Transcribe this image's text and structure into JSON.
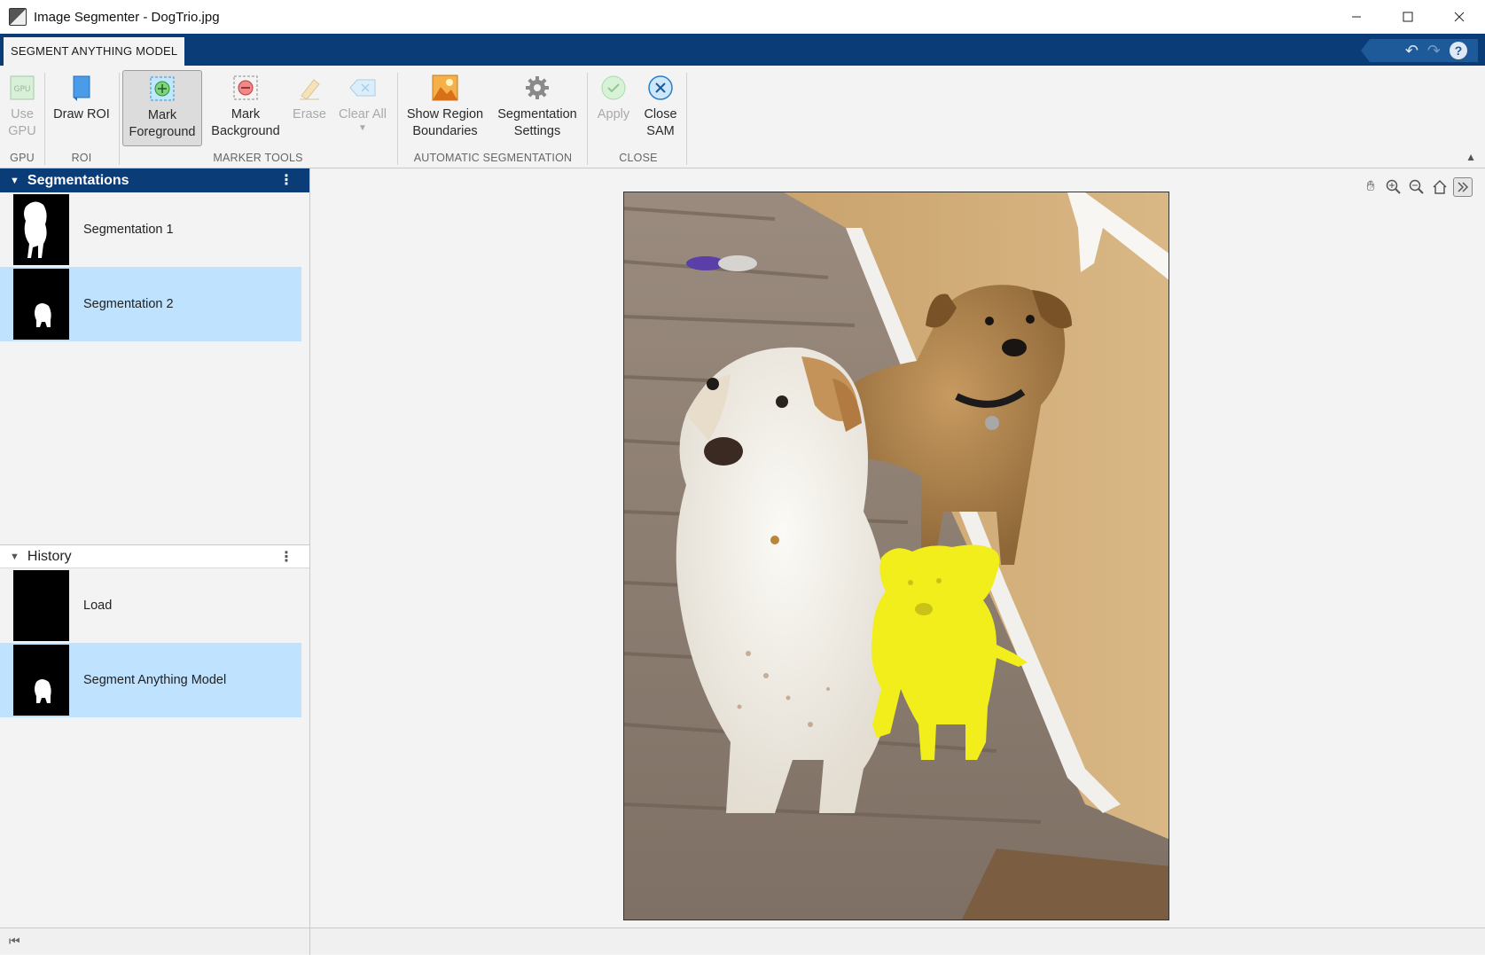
{
  "window": {
    "title": "Image Segmenter - DogTrio.jpg",
    "controls": [
      "minimize",
      "maximize",
      "close"
    ]
  },
  "tabs": [
    {
      "label": "SEGMENT ANYTHING MODEL",
      "active": true
    }
  ],
  "quick_access": {
    "undo_icon": "undo-icon",
    "redo_icon": "redo-icon",
    "help_icon": "help-icon",
    "help_glyph": "?"
  },
  "toolstrip": {
    "groups": [
      {
        "label": "GPU",
        "tools": [
          {
            "label1": "Use",
            "label2": "GPU",
            "icon": "gpu-icon",
            "icon_text": "GPU",
            "enabled": false
          }
        ]
      },
      {
        "label": "ROI",
        "tools": [
          {
            "label1": "Draw ROI",
            "icon": "draw-roi-icon",
            "enabled": true
          }
        ]
      },
      {
        "label": "MARKER TOOLS",
        "tools": [
          {
            "label1": "Mark",
            "label2": "Foreground",
            "icon": "mark-foreground-icon",
            "enabled": true,
            "selected": true
          },
          {
            "label1": "Mark",
            "label2": "Background",
            "icon": "mark-background-icon",
            "enabled": true
          },
          {
            "label1": "Erase",
            "icon": "eraser-icon",
            "enabled": false
          },
          {
            "label1": "Clear All",
            "icon": "clear-all-icon",
            "enabled": false,
            "dropdown": true
          }
        ]
      },
      {
        "label": "AUTOMATIC SEGMENTATION",
        "tools": [
          {
            "label1": "Show Region",
            "label2": "Boundaries",
            "icon": "region-boundaries-icon",
            "enabled": true
          },
          {
            "label1": "Segmentation",
            "label2": "Settings",
            "icon": "gear-icon",
            "enabled": true
          }
        ]
      },
      {
        "label": "CLOSE",
        "tools": [
          {
            "label1": "Apply",
            "icon": "check-icon",
            "enabled": false
          },
          {
            "label1": "Close",
            "label2": "SAM",
            "icon": "close-circle-icon",
            "enabled": true
          }
        ]
      }
    ]
  },
  "segmentations_panel": {
    "title": "Segmentations",
    "items": [
      {
        "label": "Segmentation 1",
        "selected": false
      },
      {
        "label": "Segmentation 2",
        "selected": true
      }
    ]
  },
  "history_panel": {
    "title": "History",
    "items": [
      {
        "label": "Load",
        "selected": false
      },
      {
        "label": "Segment Anything Model",
        "selected": true
      }
    ]
  },
  "axes_toolbar": [
    "pan-icon",
    "zoom-in-icon",
    "zoom-out-icon",
    "home-icon",
    "expand-icon"
  ],
  "image": {
    "name": "DogTrio.jpg",
    "overlay_color": "#f2ee1c"
  },
  "colors": {
    "tab_bar": "#0a3c78",
    "selection": "#bfe2fe"
  }
}
